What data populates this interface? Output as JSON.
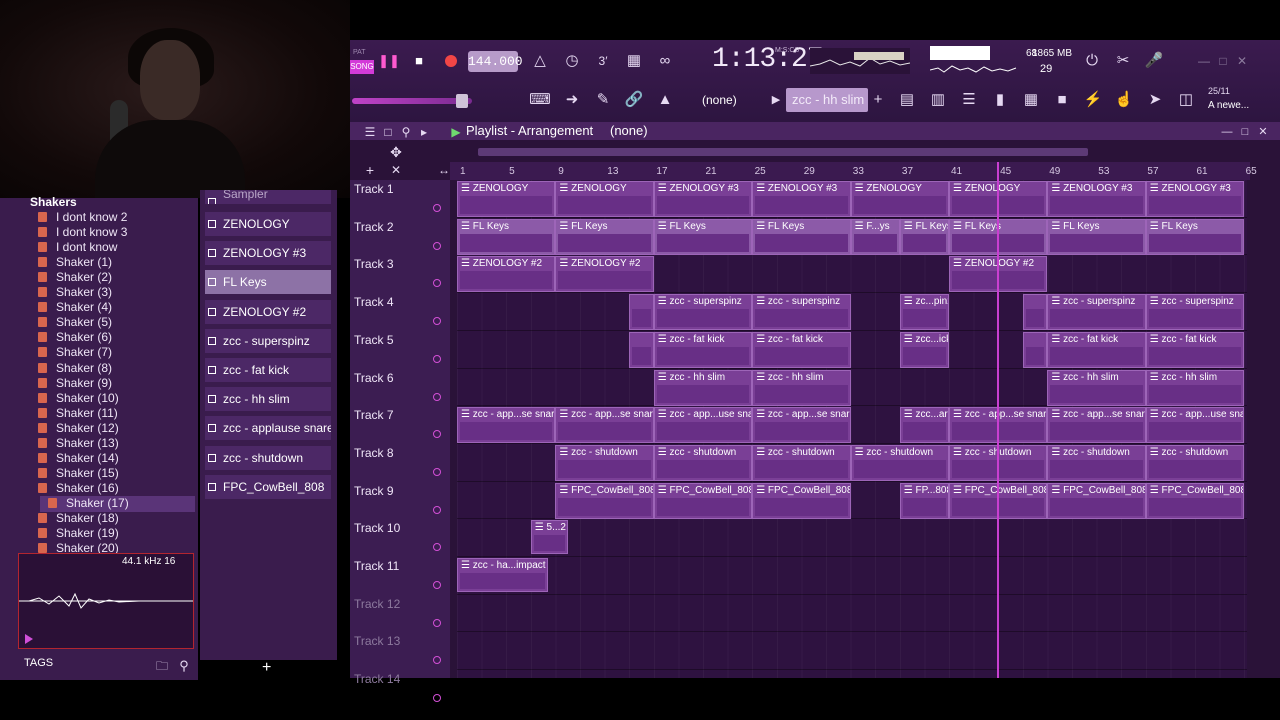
{
  "toolbar": {
    "mode_label": "SONG",
    "pat_label": "PAT",
    "tempo": "144.000",
    "time": "1:13:27",
    "time_unit": "M:S:CS",
    "cpu": "68",
    "ram": "1865 MB",
    "polyphony": "29",
    "pattern": "(none)",
    "channel": "zcc - hh slim",
    "news_date": "25/11",
    "news_text": "A newe..."
  },
  "browser": {
    "folder": "Shakers",
    "items": [
      "I dont know 2",
      "I dont know 3",
      "I dont know",
      "Shaker (1)",
      "Shaker (2)",
      "Shaker (3)",
      "Shaker (4)",
      "Shaker (5)",
      "Shaker (6)",
      "Shaker (7)",
      "Shaker (8)",
      "Shaker (9)",
      "Shaker (10)",
      "Shaker (11)",
      "Shaker (12)",
      "Shaker (13)",
      "Shaker (14)",
      "Shaker (15)",
      "Shaker (16)",
      "Shaker (17)",
      "Shaker (18)",
      "Shaker (19)",
      "Shaker (20)"
    ],
    "selected": "Shaker (17)",
    "sample_info": "44.1 kHz 16",
    "tags_label": "TAGS"
  },
  "picker": {
    "items": [
      "Sampler",
      "ZENOLOGY",
      "ZENOLOGY #3",
      "FL Keys",
      "ZENOLOGY #2",
      "zcc - superspinz",
      "zcc - fat kick",
      "zcc - hh slim",
      "zcc - applause snare",
      "zcc - shutdown",
      "FPC_CowBell_808"
    ],
    "selected": "FL Keys"
  },
  "playlist": {
    "title": "Playlist - Arrangement",
    "pattern": "(none)",
    "bars": [
      "1",
      "5",
      "9",
      "13",
      "17",
      "21",
      "25",
      "29",
      "33",
      "37",
      "41",
      "45",
      "49",
      "53",
      "57",
      "61",
      "65"
    ],
    "tracks": [
      "Track 1",
      "Track 2",
      "Track 3",
      "Track 4",
      "Track 5",
      "Track 6",
      "Track 7",
      "Track 8",
      "Track 9",
      "Track 10",
      "Track 11",
      "Track 12",
      "Track 13",
      "Track 14"
    ],
    "clips": {
      "t1": [
        "ZENOLOGY",
        "ZENOLOGY",
        "ZENOLOGY #3",
        "ZENOLOGY #3",
        "ZENOLOGY",
        "ZENOLOGY",
        "ZENOLOGY #3",
        "ZENOLOGY #3"
      ],
      "t2": [
        "FL Keys",
        "FL Keys",
        "FL Keys",
        "FL Keys",
        "F...ys",
        "FL Keys",
        "FL Keys",
        "FL Keys",
        "FL Keys"
      ],
      "t3": [
        "ZENOLOGY #2",
        "ZENOLOGY #2",
        "ZENOLOGY #2"
      ],
      "t4": [
        "zcc - superspinz",
        "zcc - superspinz",
        "zc...pinz",
        "zcc - superspinz",
        "zcc - superspinz"
      ],
      "t5": [
        "zcc - fat kick",
        "zcc - fat kick",
        "zcc...ick",
        "zcc - fat kick",
        "zcc - fat kick"
      ],
      "t6": [
        "zcc - hh slim",
        "zcc - hh slim",
        "zcc - hh slim",
        "zcc - hh slim"
      ],
      "t7": [
        "zcc - app...se snare",
        "zcc - app...se snare",
        "zcc - app...use snare",
        "zcc - app...se snare",
        "zcc...are",
        "zcc - app...se snare",
        "zcc - app...se snare",
        "zcc - app...use snare"
      ],
      "t8": [
        "zcc - shutdown",
        "zcc - shutdown",
        "zcc - shutdown",
        "zcc - shutdown",
        "zcc - shutdown",
        "zcc - shutdown",
        "zcc - shutdown"
      ],
      "t9": [
        "FPC_CowBell_808",
        "FPC_CowBell_808",
        "FPC_CowBell_808",
        "FP...808",
        "FPC_CowBell_808",
        "FPC_CowBell_808",
        "FPC_CowBell_808"
      ],
      "t10": [
        "5...2"
      ],
      "t11": [
        "zcc - ha...impact"
      ]
    }
  }
}
